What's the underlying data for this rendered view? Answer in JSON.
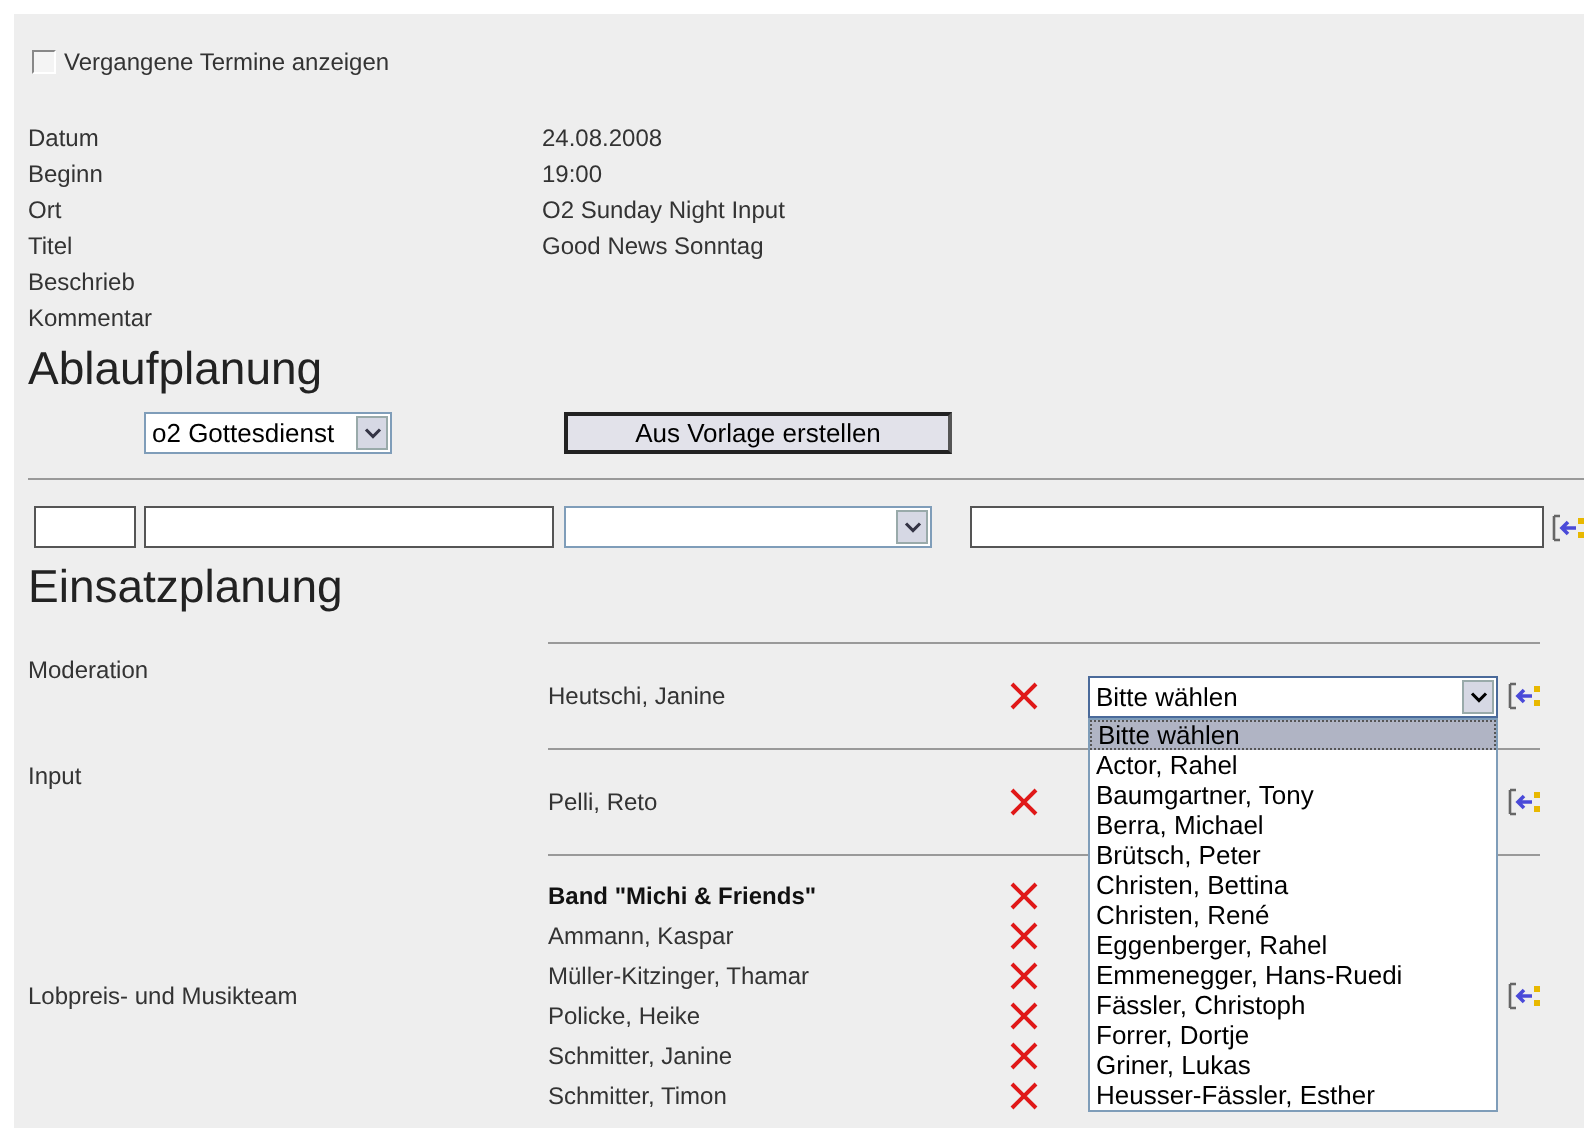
{
  "past_events": {
    "label": "Vergangene Termine anzeigen",
    "checked": false
  },
  "details": [
    {
      "label": "Datum",
      "value": "24.08.2008"
    },
    {
      "label": "Beginn",
      "value": "19:00"
    },
    {
      "label": "Ort",
      "value": "O2 Sunday Night Input"
    },
    {
      "label": "Titel",
      "value": "Good News Sonntag"
    },
    {
      "label": "Beschrieb"
    },
    {
      "label": "Kommentar"
    }
  ],
  "ablaufplanung": {
    "heading": "Ablaufplanung",
    "template_select": "o2 Gottesdienst",
    "button": "Aus Vorlage erstellen",
    "fields": [
      {
        "kind": "text"
      },
      {
        "kind": "text"
      },
      {
        "kind": "select"
      },
      {
        "kind": "text"
      }
    ]
  },
  "einsatzplanung": {
    "heading": "Einsatzplanung",
    "sections": [
      {
        "label": "Moderation",
        "members": [
          {
            "name": "Heutschi, Janine",
            "bold": false
          }
        ],
        "select": {
          "value": "Bitte wählen",
          "expanded": true,
          "options": [
            {
              "label": "Bitte wählen",
              "selected": true
            },
            {
              "label": "Actor, Rahel",
              "selected": false
            },
            {
              "label": "Baumgartner, Tony",
              "selected": false
            },
            {
              "label": "Berra, Michael",
              "selected": false
            },
            {
              "label": "Brütsch, Peter",
              "selected": false
            },
            {
              "label": "Christen, Bettina",
              "selected": false
            },
            {
              "label": "Christen, René",
              "selected": false
            },
            {
              "label": "Eggenberger, Rahel",
              "selected": false
            },
            {
              "label": "Emmenegger, Hans-Ruedi",
              "selected": false
            },
            {
              "label": "Fässler, Christoph",
              "selected": false
            },
            {
              "label": "Forrer, Dortje",
              "selected": false
            },
            {
              "label": "Griner, Lukas",
              "selected": false
            },
            {
              "label": "Heusser-Fässler, Esther",
              "selected": false
            }
          ]
        }
      },
      {
        "label": "Input",
        "members": [
          {
            "name": "Pelli, Reto",
            "bold": false
          }
        ]
      },
      {
        "label": "Lobpreis- und Musikteam",
        "members": [
          {
            "name": "Band \"Michi & Friends\"",
            "bold": true
          },
          {
            "name": "Ammann, Kaspar",
            "bold": false
          },
          {
            "name": "Müller-Kitzinger, Thamar",
            "bold": false
          },
          {
            "name": "Policke, Heike",
            "bold": false
          },
          {
            "name": "Schmitter, Janine",
            "bold": false
          },
          {
            "name": "Schmitter, Timon",
            "bold": false
          }
        ]
      }
    ]
  }
}
